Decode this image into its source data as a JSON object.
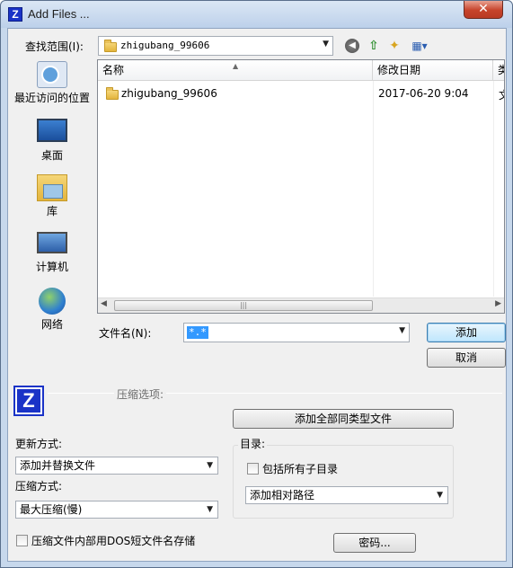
{
  "window": {
    "title": "Add Files ...",
    "close_glyph": "✕"
  },
  "toolbar": {
    "lookin_label": "查找范围(I):",
    "lookin_value": "zhigubang_99606",
    "combo_arrow": "▼",
    "back_glyph": "◀",
    "up_glyph": "⇧",
    "newfolder_glyph": "✦",
    "views_glyph": "▦▾"
  },
  "places": [
    {
      "label": "最近访问的位置",
      "icon": "recent-places-icon"
    },
    {
      "label": "桌面",
      "icon": "desktop-icon"
    },
    {
      "label": "库",
      "icon": "library-icon"
    },
    {
      "label": "计算机",
      "icon": "computer-icon"
    },
    {
      "label": "网络",
      "icon": "network-icon"
    }
  ],
  "filelist": {
    "columns": [
      "名称",
      "修改日期",
      "类"
    ],
    "sort_glyph": "▲",
    "rows": [
      {
        "name": "zhigubang_99606",
        "date": "2017-06-20 9:04",
        "type": "文"
      }
    ],
    "scroll_left": "◀",
    "scroll_right": "▶",
    "scroll_grip": "|||"
  },
  "filename": {
    "label": "文件名(N):",
    "value": "*.*",
    "arrow": "▼"
  },
  "buttons": {
    "add": "添加",
    "cancel": "取消",
    "add_all_same_type": "添加全部同类型文件",
    "password": "密码..."
  },
  "options": {
    "section_title": "压缩选项:",
    "update_label": "更新方式:",
    "update_value": "添加并替换文件",
    "compress_label": "压缩方式:",
    "compress_value": "最大压缩(慢)",
    "dos_names_label": "压缩文件内部用DOS短文件名存储",
    "dir_label": "目录:",
    "include_subdirs_label": "包括所有子目录",
    "path_value": "添加相对路径",
    "select_arrow": "▼"
  }
}
